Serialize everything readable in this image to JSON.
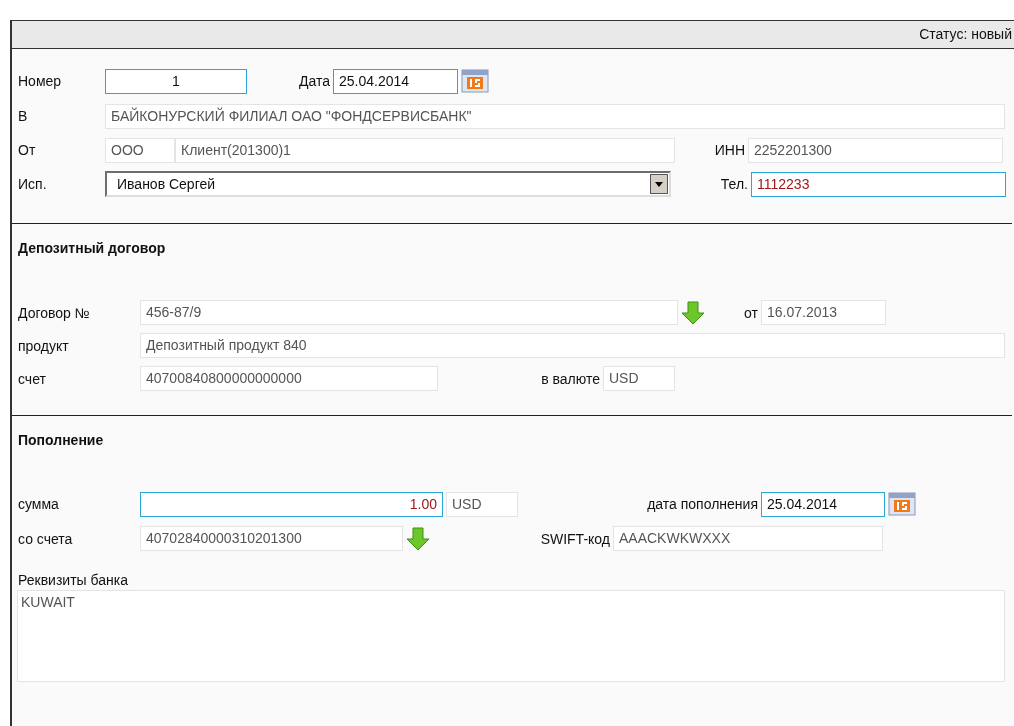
{
  "status_bar": {
    "text": "Статус: новый"
  },
  "header": {
    "number": {
      "label": "Номер",
      "value": "1",
      "editable": true
    },
    "date": {
      "label": "Дата",
      "value": "25.04.2014",
      "editable": true
    },
    "to": {
      "label": "В",
      "value": "БАЙКОНУРСКИЙ ФИЛИАЛ ОАО \"ФОНДСЕРВИСБАНК\"",
      "editable": false
    },
    "from": {
      "label": "От",
      "form": "ООО",
      "value": "Клиент(201300)1",
      "editable": false
    },
    "inn": {
      "label": "ИНН",
      "value": "2252201300",
      "editable": false
    },
    "executor": {
      "label": "Исп.",
      "value": "Иванов Сергей"
    },
    "phone": {
      "label": "Тел.",
      "value": "1112233",
      "editable": true,
      "red": true
    }
  },
  "contract": {
    "title": "Депозитный договор",
    "number": {
      "label": "Договор №",
      "value": "456-87/9",
      "editable": false
    },
    "date": {
      "label": "от",
      "value": "16.07.2013",
      "editable": false
    },
    "product": {
      "label": "продукт",
      "value": "Депозитный продукт 840",
      "editable": false
    },
    "account": {
      "label": "счет",
      "value": "40700840800000000000",
      "editable": false
    },
    "currency": {
      "label": "в валюте",
      "value": "USD",
      "editable": false
    }
  },
  "topup": {
    "title": "Пополнение",
    "amount": {
      "label": "сумма",
      "value": "1.00",
      "editable": true,
      "red": true
    },
    "currency": {
      "value": "USD",
      "editable": false
    },
    "date": {
      "label": "дата пополнения",
      "value": "25.04.2014",
      "editable": true
    },
    "from_account": {
      "label": "со счета",
      "value": "40702840000310201300",
      "editable": false
    },
    "swift": {
      "label": "SWIFT-код",
      "value": "AAACKWKWXXX",
      "editable": false
    },
    "bank_details": {
      "label": "Реквизиты банка",
      "value": "KUWAIT"
    }
  }
}
